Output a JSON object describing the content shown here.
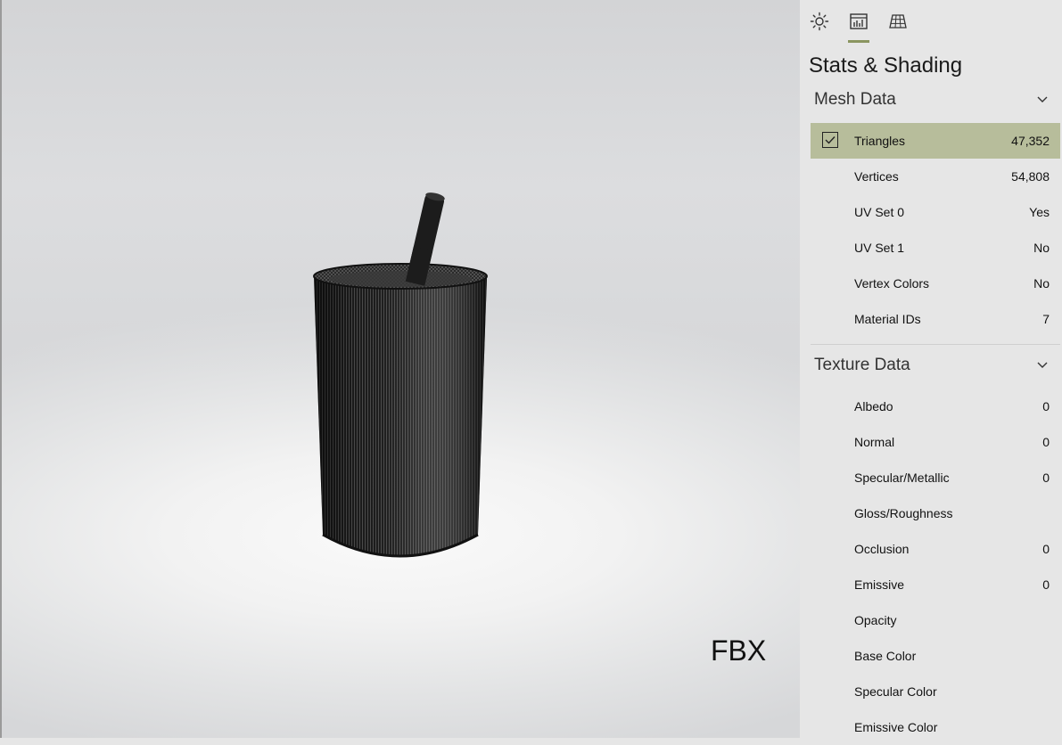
{
  "viewport": {
    "format_label": "FBX"
  },
  "panel": {
    "tabs": [
      {
        "icon": "sun-icon"
      },
      {
        "icon": "stats-icon",
        "active": true
      },
      {
        "icon": "grid-icon"
      }
    ],
    "title": "Stats & Shading",
    "accent_color": "#b7bd9b",
    "mesh_data": {
      "header": "Mesh Data",
      "rows": [
        {
          "label": "Triangles",
          "value": "47,352",
          "checked": true
        },
        {
          "label": "Vertices",
          "value": "54,808"
        },
        {
          "label": "UV Set 0",
          "value": "Yes"
        },
        {
          "label": "UV Set 1",
          "value": "No"
        },
        {
          "label": "Vertex Colors",
          "value": "No"
        },
        {
          "label": "Material IDs",
          "value": "7"
        }
      ]
    },
    "texture_data": {
      "header": "Texture Data",
      "rows": [
        {
          "label": "Albedo",
          "value": "0"
        },
        {
          "label": "Normal",
          "value": "0"
        },
        {
          "label": "Specular/Metallic",
          "value": "0"
        },
        {
          "label": "Gloss/Roughness",
          "value": ""
        },
        {
          "label": "Occlusion",
          "value": "0"
        },
        {
          "label": "Emissive",
          "value": "0"
        },
        {
          "label": "Opacity",
          "value": ""
        },
        {
          "label": "Base Color",
          "value": ""
        },
        {
          "label": "Specular Color",
          "value": ""
        },
        {
          "label": "Emissive Color",
          "value": ""
        }
      ]
    }
  }
}
